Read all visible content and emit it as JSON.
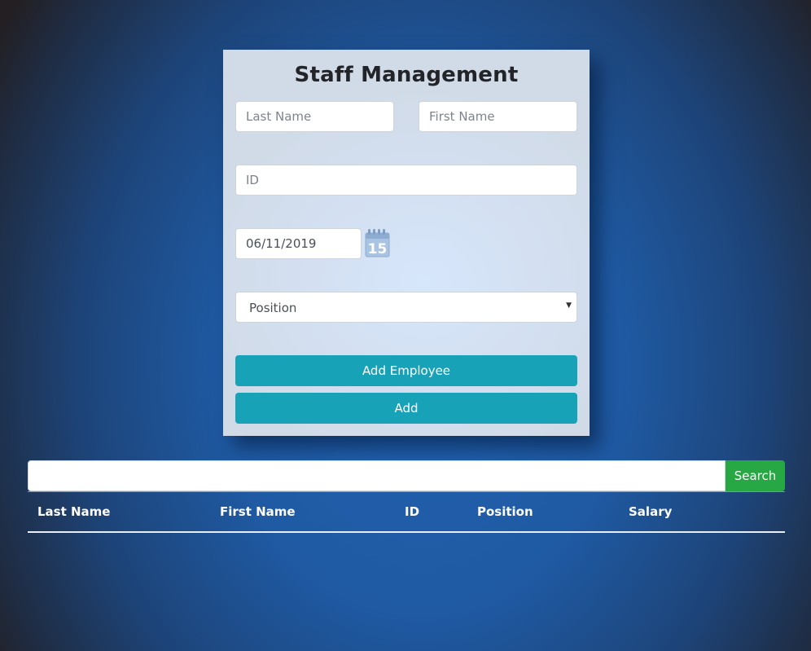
{
  "form": {
    "title": "Staff Management",
    "last_name_placeholder": "Last Name",
    "first_name_placeholder": "First Name",
    "id_placeholder": "ID",
    "date_value": "06/11/2019",
    "calendar_day": "15",
    "position_selected": "Position",
    "add_employee_label": "Add Employee",
    "add_label": "Add"
  },
  "search": {
    "value": "",
    "button_label": "Search"
  },
  "table": {
    "headers": [
      "Last Name",
      "First Name",
      "ID",
      "Position",
      "Salary"
    ]
  },
  "colors": {
    "button_teal": "#17a2b8",
    "search_green": "#28a745"
  }
}
